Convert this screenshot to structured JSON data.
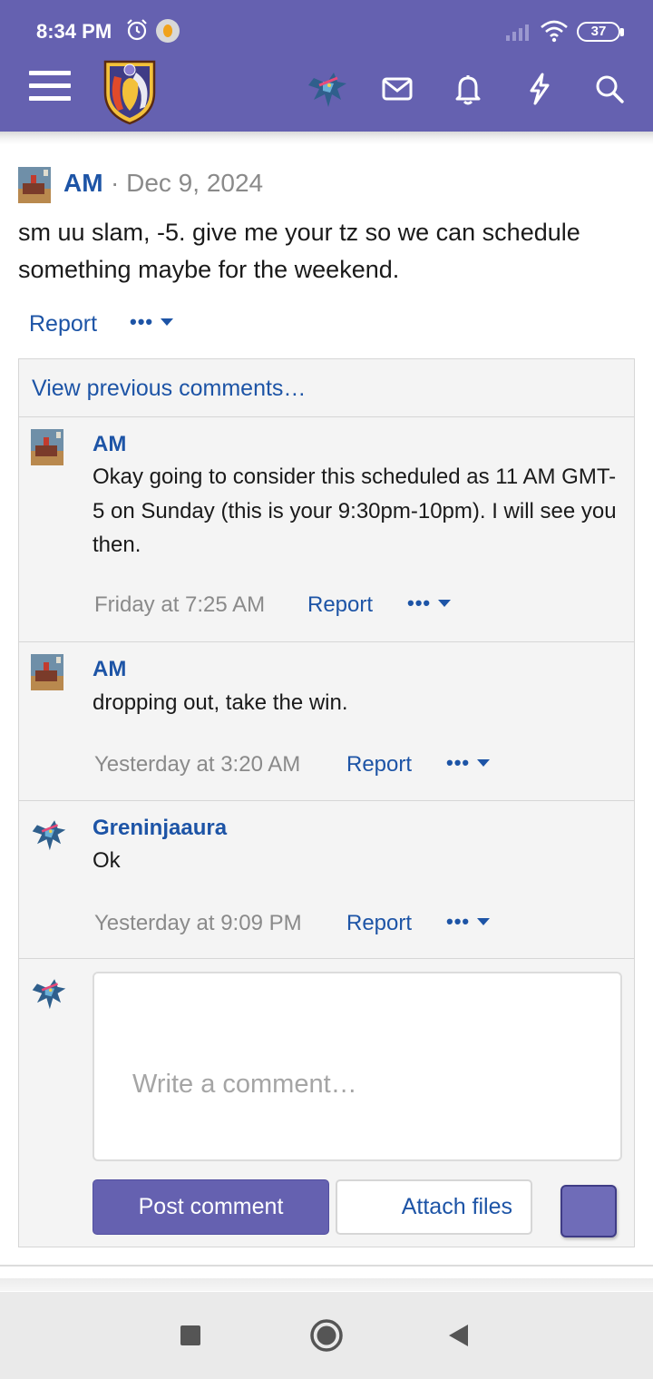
{
  "status_bar": {
    "time": "8:34 PM",
    "battery": "37"
  },
  "header": {
    "icons": [
      "menu-icon",
      "forum-logo",
      "user-avatar",
      "mail-icon",
      "bell-icon",
      "bolt-icon",
      "search-icon"
    ],
    "color": "#6561b0"
  },
  "post": {
    "author": "AM",
    "separator": "·",
    "date": "Dec 9, 2024",
    "body": "sm uu slam, -5. give me your tz so we can schedule something maybe for the weekend.",
    "report_label": "Report",
    "more_label": "•••"
  },
  "comments": {
    "view_previous": "View previous comments…",
    "items": [
      {
        "author": "AM",
        "text": "Okay going to consider this scheduled as 11 AM GMT-5 on Sunday (this is your 9:30pm-10pm). I will see you then.",
        "time": "Friday at 7:25 AM",
        "report_label": "Report",
        "more_label": "•••"
      },
      {
        "author": "AM",
        "text": "dropping out, take the win.",
        "time": "Yesterday at 3:20 AM",
        "report_label": "Report",
        "more_label": "•••"
      },
      {
        "author": "Greninjaaura",
        "text": "Ok",
        "time": "Yesterday at 9:09 PM",
        "report_label": "Report",
        "more_label": "•••"
      }
    ],
    "input_placeholder": "Write a comment…",
    "post_button": "Post comment",
    "attach_button": "Attach files"
  },
  "colors": {
    "accent": "#6561b0",
    "link": "#1d54a6",
    "muted": "#8a8a8a"
  }
}
